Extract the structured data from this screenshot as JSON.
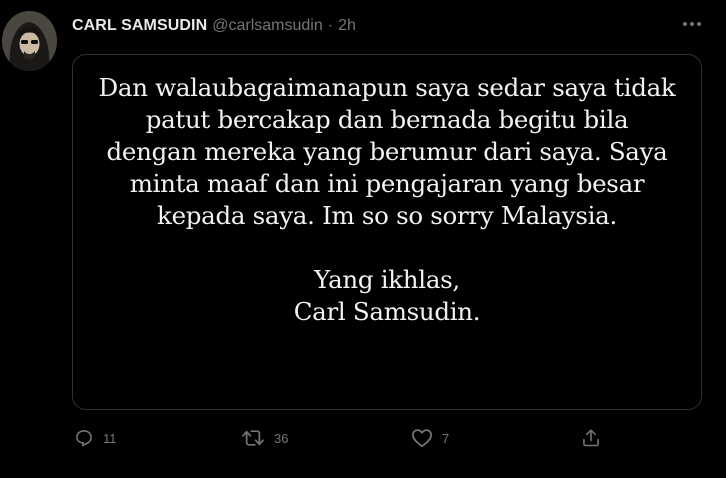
{
  "tweet": {
    "author_name": "CARL SAMSUDIN",
    "handle": "@carlsamsudin",
    "separator": "·",
    "time": "2h",
    "image_text": {
      "lines": [
        "Dan walaubagaimanapun saya sedar saya tidak",
        "patut bercakap dan bernada begitu bila",
        "dengan mereka yang berumur dari saya. Saya",
        "minta maaf dan ini pengajaran yang besar",
        "kepada saya. Im so so sorry Malaysia."
      ],
      "closing": "Yang ikhlas,",
      "signature": "Carl Samsudin."
    }
  },
  "actions": {
    "reply": {
      "icon": "reply-icon",
      "count": "11"
    },
    "retweet": {
      "icon": "retweet-icon",
      "count": "36"
    },
    "like": {
      "icon": "heart-icon",
      "count": "7"
    },
    "share": {
      "icon": "share-icon"
    }
  },
  "colors": {
    "background": "#000000",
    "text": "#e7e9ea",
    "muted": "#71767b",
    "border": "#2f3336"
  }
}
